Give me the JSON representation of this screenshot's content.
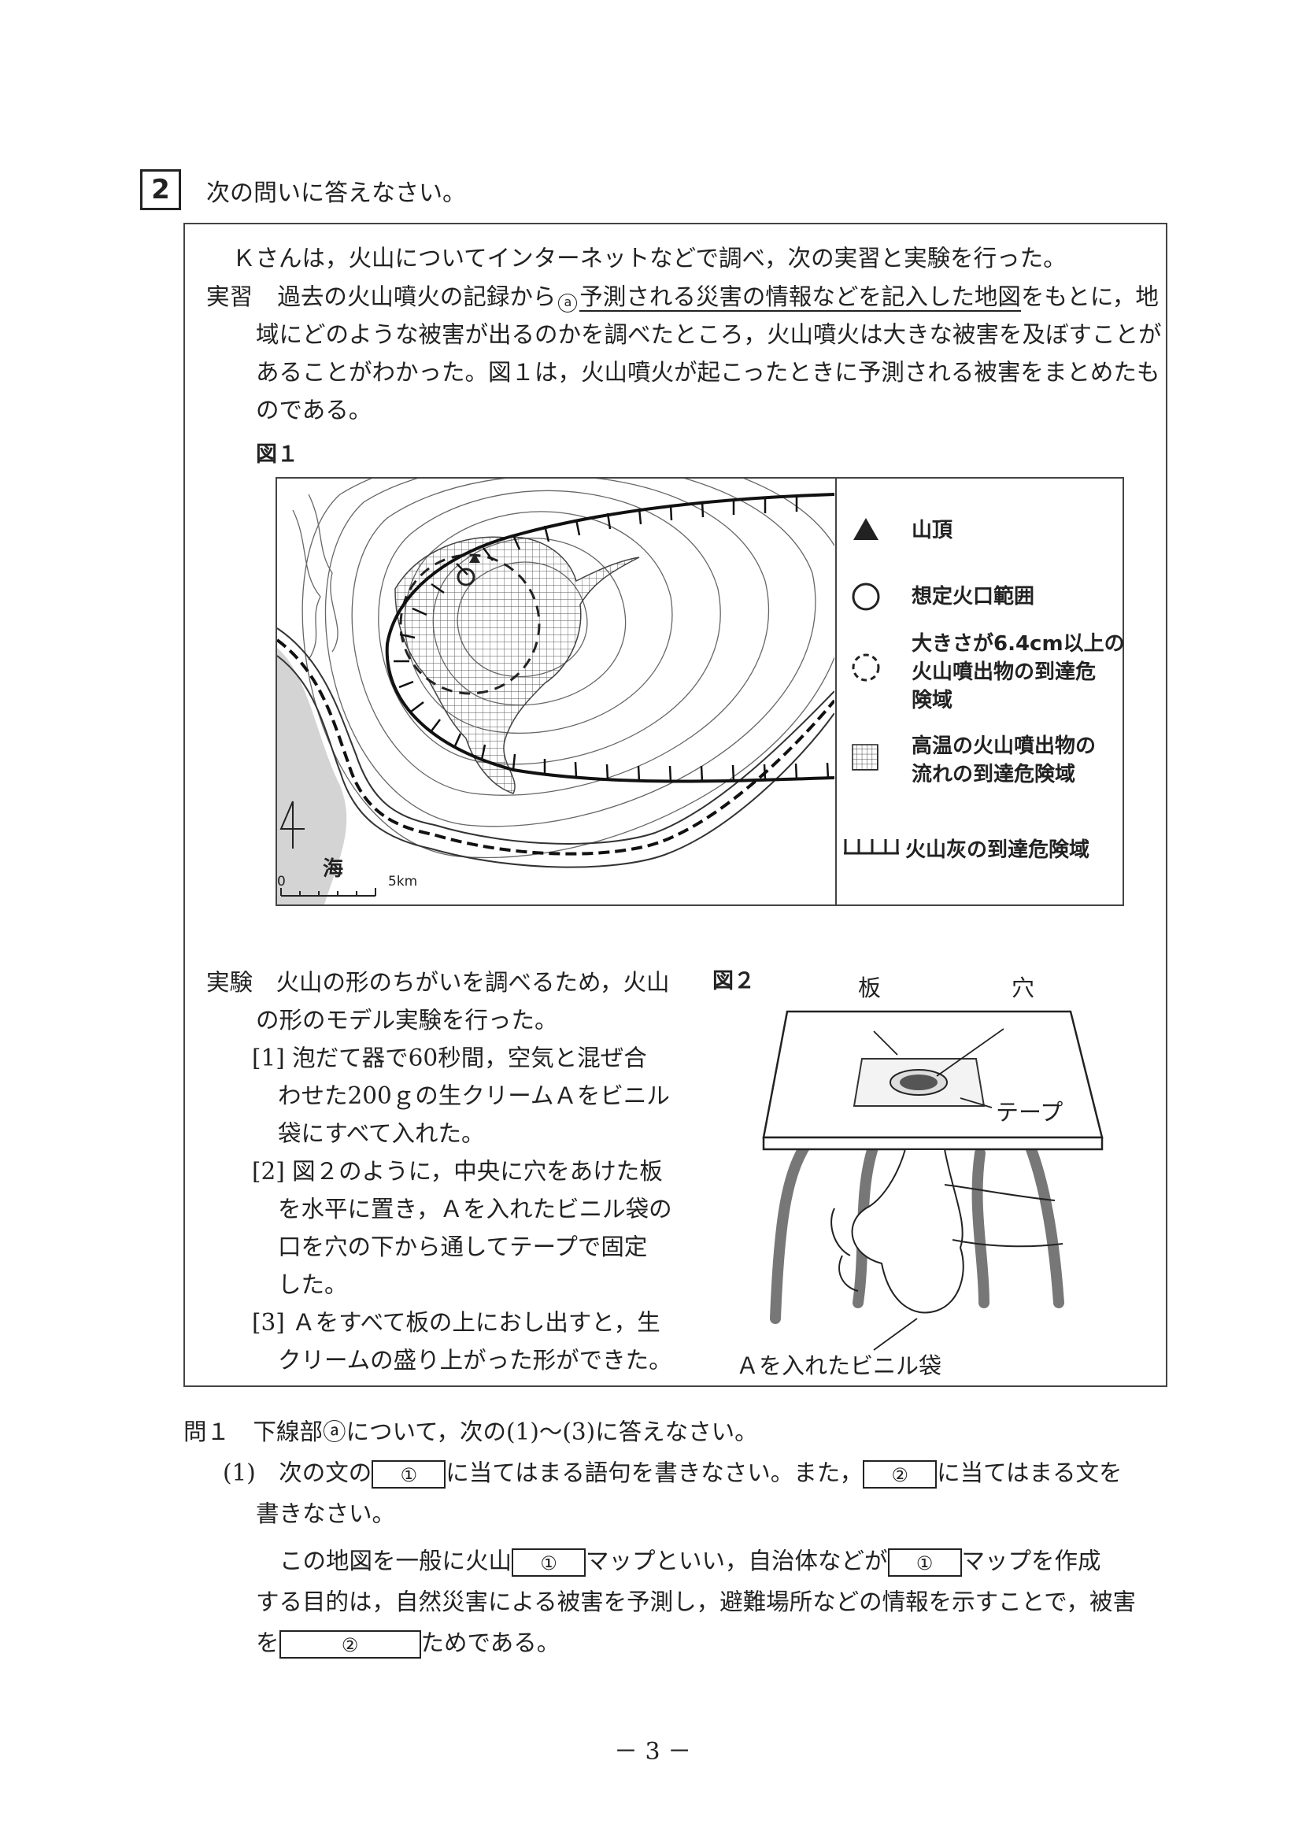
{
  "question": {
    "number": "2",
    "instruction": "次の問いに答えなさい。"
  },
  "intro": {
    "line1": "Ｋさんは，火山についてインターネットなどで調べ，次の実習と実験を行った。",
    "practice_label": "実習",
    "practice_pre": "過去の火山噴火の記録から",
    "marker": "a",
    "practice_underlined": "予測される災害の情報などを記入した地図",
    "practice_post": "をもとに，地",
    "line3": "域にどのような被害が出るのかを調べたところ，火山噴火は大きな被害を及ぼすことが",
    "line4": "あることがわかった。図１は，火山噴火が起こったときに予測される被害をまとめたも",
    "line5": "のである。"
  },
  "figure1": {
    "label": "図１",
    "sea_label": "海",
    "scale_zero": "0",
    "scale_end": "5km",
    "legend": [
      {
        "icon": "triangle-icon",
        "text": "山頂"
      },
      {
        "icon": "circle-icon",
        "text": "想定火口範囲"
      },
      {
        "icon": "dashed-circle-icon",
        "lines": [
          "大きさが6.4cm以上の",
          "火山噴出物の到達危",
          "険域"
        ]
      },
      {
        "icon": "grid-icon",
        "lines": [
          "高温の火山噴出物の",
          "流れの到達危険域"
        ]
      },
      {
        "icon": "hatch-line-icon",
        "text": "火山灰の到達危険域"
      }
    ]
  },
  "experiment": {
    "lines": [
      "実験　火山の形のちがいを調べるため，火山",
      "の形のモデル実験を行った。",
      "[1] 泡だて器で60秒間，空気と混ぜ合",
      "わせた200ｇの生クリームＡをビニル",
      "袋にすべて入れた。",
      "[2] 図２のように，中央に穴をあけた板",
      "を水平に置き，Ａを入れたビニル袋の",
      "口を穴の下から通してテープで固定",
      "した。",
      "[3] Ａをすべて板の上におし出すと，生",
      "クリームの盛り上がった形ができた。"
    ]
  },
  "figure2": {
    "label": "図２",
    "board": "板",
    "hole": "穴",
    "tape": "テープ",
    "bag": "Ａを入れたビニル袋"
  },
  "q1": {
    "heading": "問１　下線部ⓐについて，次の(1)～(3)に答えなさい。",
    "sub_pre": "(1)　次の文の",
    "blank1": "①",
    "sub_mid": "に当てはまる語句を書きなさい。また，",
    "blank2": "②",
    "sub_post": "に当てはまる文を",
    "sub_line2": "書きなさい。",
    "s1_pre": "この地図を一般に火山",
    "s1_mid": "マップといい，自治体などが",
    "s1_post": "マップを作成",
    "s2": "する目的は，自然災害による被害を予測し，避難場所などの情報を示すことで，被害",
    "s3_pre": "を",
    "s3_post": "ためである。"
  },
  "page_number": "－ 3 －"
}
